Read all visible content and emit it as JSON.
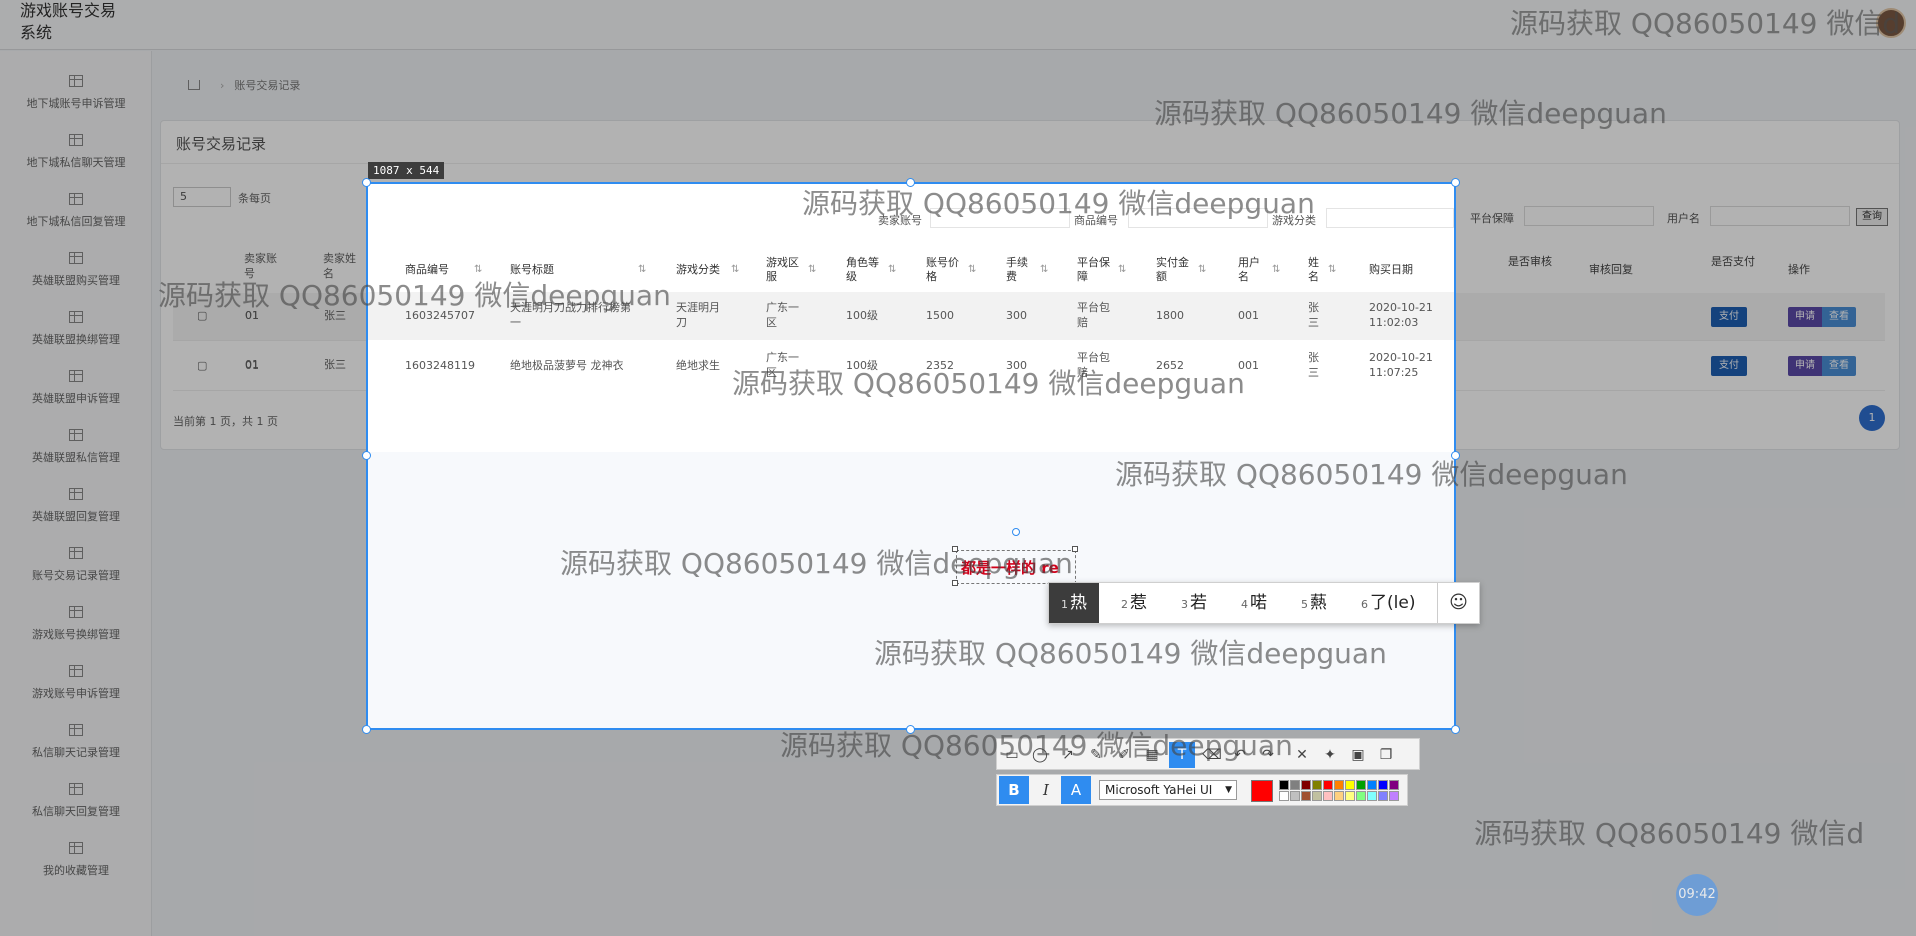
{
  "app": {
    "title": "游戏账号交易系统"
  },
  "sidebar": {
    "items": [
      {
        "label": "地下城账号申诉管理"
      },
      {
        "label": "地下城私信聊天管理"
      },
      {
        "label": "地下城私信回复管理"
      },
      {
        "label": "英雄联盟购买管理"
      },
      {
        "label": "英雄联盟换绑管理"
      },
      {
        "label": "英雄联盟申诉管理"
      },
      {
        "label": "英雄联盟私信管理"
      },
      {
        "label": "英雄联盟回复管理"
      },
      {
        "label": "账号交易记录管理"
      },
      {
        "label": "游戏账号换绑管理"
      },
      {
        "label": "游戏账号申诉管理"
      },
      {
        "label": "私信聊天记录管理"
      },
      {
        "label": "私信聊天回复管理"
      },
      {
        "label": "我的收藏管理"
      }
    ]
  },
  "breadcrumb": {
    "current": "账号交易记录"
  },
  "card": {
    "title": "账号交易记录",
    "page_size": "5",
    "page_size_label": "条每页",
    "pager_text": "当前第 1 页，共 1 页",
    "page_num": "1"
  },
  "filters": {
    "seller_account": "卖家账号",
    "product_no": "商品编号",
    "game_category": "游戏分类",
    "platform_guarantee": "平台保障",
    "username": "用户名",
    "search": "查询"
  },
  "table": {
    "headers": [
      "卖家账号",
      "卖家姓名",
      "商品编号",
      "账号标题",
      "游戏分类",
      "游戏区服",
      "角色等级",
      "账号价格",
      "手续费",
      "平台保障",
      "实付金额",
      "用户名",
      "姓名",
      "购买日期",
      "是否审核",
      "审核回复",
      "是否支付",
      "操作"
    ],
    "rows": [
      {
        "seller_account": "01",
        "seller_name": "张三",
        "product_no": "1603245707",
        "title": "天涯明月刀战力排行榜第一",
        "category": "天涯明月刀",
        "server": "广东一区",
        "level": "100级",
        "price": "1500",
        "fee": "300",
        "guarantee": "平台包赔",
        "paid": "1800",
        "username": "001",
        "name": "张三",
        "date": "2020-10-21 11:02:03"
      },
      {
        "seller_account": "01",
        "seller_name": "张三",
        "product_no": "1603248119",
        "title": "绝地极品菠萝号 龙神衣",
        "category": "绝地求生",
        "server": "广东一区",
        "level": "100级",
        "price": "2352",
        "fee": "300",
        "guarantee": "平台包赔",
        "paid": "2652",
        "username": "001",
        "name": "张三",
        "date": "2020-10-21 11:07:25"
      }
    ],
    "btn_pay": "支付",
    "btn_apply": "申请",
    "btn_view": "查看"
  },
  "snip": {
    "size": "1087 x 544",
    "annotation_text": "都是一样的 re",
    "font": "Microsoft YaHei UI",
    "current_color": "#ff0000",
    "palette": [
      "#000000",
      "#808080",
      "#800000",
      "#808000",
      "#ff0000",
      "#ff8000",
      "#ffff00",
      "#00a000",
      "#0080ff",
      "#0000ff",
      "#800080",
      "#ffffff",
      "#c0c0c0",
      "#a05030",
      "#c0c0a0",
      "#ffc0c0",
      "#ffd080",
      "#ffff80",
      "#80ff80",
      "#80ffff",
      "#8080ff",
      "#c080ff"
    ],
    "toolbar_icons": [
      "rect-icon",
      "ellipse-icon",
      "arrow-icon",
      "pen-icon",
      "marker-icon",
      "mosaic-icon",
      "text-icon",
      "eraser-icon",
      "undo-icon",
      "redo-icon",
      "close-icon",
      "pin-icon",
      "save-icon",
      "copy-icon"
    ],
    "format": {
      "bold": "B",
      "italic": "I",
      "outline": "A"
    }
  },
  "ime": {
    "candidates": [
      {
        "n": "1",
        "text": "热"
      },
      {
        "n": "2",
        "text": "惹"
      },
      {
        "n": "3",
        "text": "若"
      },
      {
        "n": "4",
        "text": "喏"
      },
      {
        "n": "5",
        "text": "爇"
      },
      {
        "n": "6",
        "text": "了(le)"
      }
    ],
    "emoji": "☺"
  },
  "clock": {
    "time": "09:42"
  },
  "watermark": {
    "text": "源码获取 QQ86050149 微信deepguan",
    "text_top": "源码获取 QQ86050149 微信d"
  }
}
